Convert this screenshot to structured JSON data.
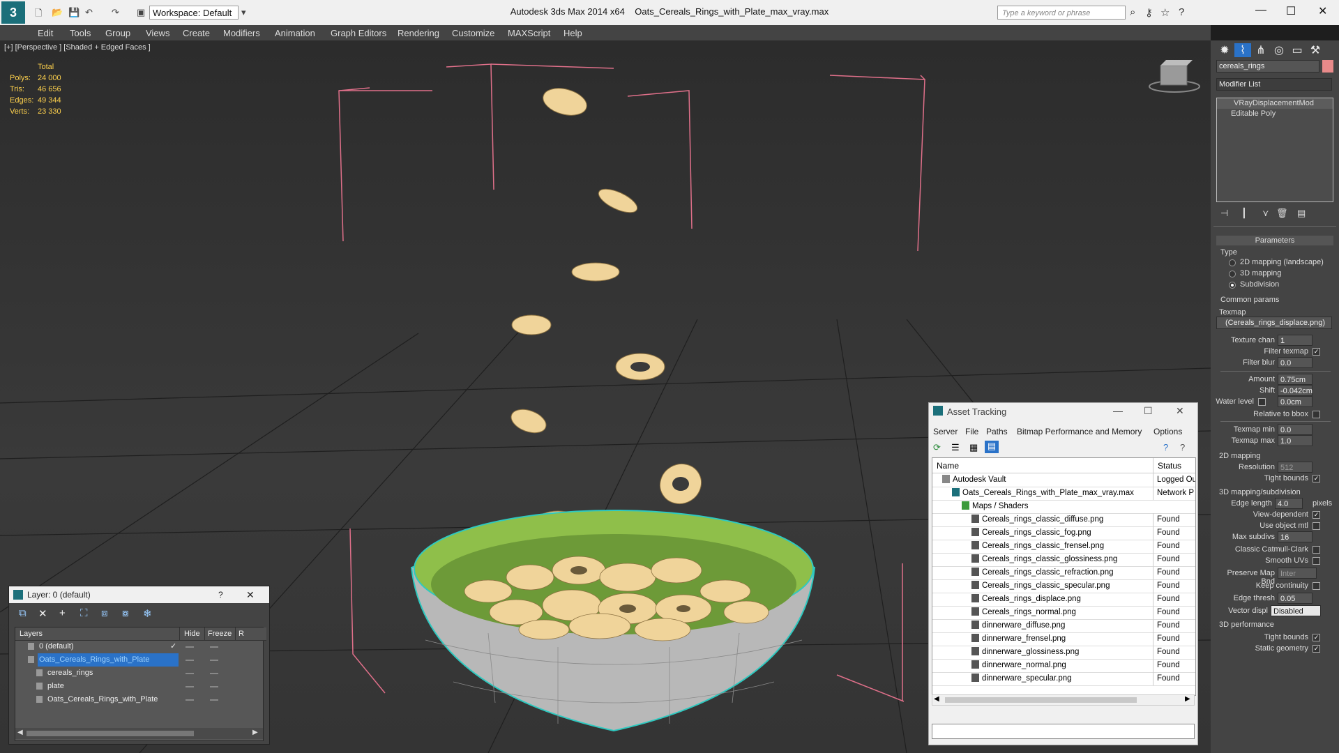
{
  "app": {
    "title": "Autodesk 3ds Max  2014 x64",
    "filename": "Oats_Cereals_Rings_with_Plate_max_vray.max",
    "workspace": "Workspace: Default",
    "search_placeholder": "Type a keyword or phrase"
  },
  "menu": [
    "Edit",
    "Tools",
    "Group",
    "Views",
    "Create",
    "Modifiers",
    "Animation",
    "Graph Editors",
    "Rendering",
    "Customize",
    "MAXScript",
    "Help"
  ],
  "viewport": {
    "label": "[+] [Perspective ] [Shaded + Edged Faces ]",
    "stats": {
      "header": "Total",
      "rows": [
        {
          "label": "Polys:",
          "value": "24 000"
        },
        {
          "label": "Tris:",
          "value": "46 656"
        },
        {
          "label": "Edges:",
          "value": "49 344"
        },
        {
          "label": "Verts:",
          "value": "23 330"
        }
      ]
    }
  },
  "command_panel": {
    "object_name": "cereals_rings",
    "modifier_list": "Modifier List",
    "stack": [
      "VRayDisplacementMod",
      "Editable Poly"
    ],
    "rollout_title": "Parameters",
    "type_label": "Type",
    "type_options": [
      {
        "label": "2D mapping (landscape)",
        "selected": false
      },
      {
        "label": "3D mapping",
        "selected": false
      },
      {
        "label": "Subdivision",
        "selected": true
      }
    ],
    "common_params": "Common params",
    "texmap_label": "Texmap",
    "texmap_value": "(Cereals_rings_displace.png)",
    "texture_chan_label": "Texture chan",
    "texture_chan_value": "1",
    "filter_texmap_label": "Filter texmap",
    "filter_blur_label": "Filter blur",
    "filter_blur_value": "0.0",
    "amount_label": "Amount",
    "amount_value": "0.75cm",
    "shift_label": "Shift",
    "shift_value": "-0.042cm",
    "water_level_label": "Water level",
    "water_level_value": "0.0cm",
    "relative_bbox_label": "Relative to bbox",
    "texmap_min_label": "Texmap min",
    "texmap_min_value": "0.0",
    "texmap_max_label": "Texmap max",
    "texmap_max_value": "1.0",
    "mapping2d_label": "2D mapping",
    "resolution_label": "Resolution",
    "resolution_value": "512",
    "tight_bounds_label": "Tight bounds",
    "mapping3d_label": "3D mapping/subdivision",
    "edge_length_label": "Edge length",
    "edge_length_value": "4.0",
    "edge_length_unit": "pixels",
    "view_dependent_label": "View-dependent",
    "use_object_mtl_label": "Use object mtl",
    "max_subdivs_label": "Max subdivs",
    "max_subdivs_value": "16",
    "classic_catmull_label": "Classic Catmull-Clark",
    "smooth_uvs_label": "Smooth UVs",
    "preserve_map_label": "Preserve Map Bnd",
    "preserve_map_value": "Inter",
    "keep_continuity_label": "Keep continuity",
    "edge_thresh_label": "Edge thresh",
    "edge_thresh_value": "0.05",
    "vector_displ_label": "Vector displ",
    "vector_displ_value": "Disabled",
    "performance_label": "3D performance",
    "tight_bounds2_label": "Tight bounds",
    "static_geometry_label": "Static geometry"
  },
  "asset_tracking": {
    "title": "Asset Tracking",
    "menu": [
      "Server",
      "File",
      "Paths",
      "Bitmap Performance and Memory",
      "Options"
    ],
    "columns": [
      "Name",
      "Status"
    ],
    "rows": [
      {
        "name": "Autodesk Vault",
        "status": "Logged Ou",
        "indent": 0,
        "kind": "vault"
      },
      {
        "name": "Oats_Cereals_Rings_with_Plate_max_vray.max",
        "status": "Network P",
        "indent": 1,
        "kind": "max"
      },
      {
        "name": "Maps / Shaders",
        "status": "",
        "indent": 2,
        "kind": "folder"
      },
      {
        "name": "Cereals_rings_classic_diffuse.png",
        "status": "Found",
        "indent": 3,
        "kind": "file"
      },
      {
        "name": "Cereals_rings_classic_fog.png",
        "status": "Found",
        "indent": 3,
        "kind": "file"
      },
      {
        "name": "Cereals_rings_classic_frensel.png",
        "status": "Found",
        "indent": 3,
        "kind": "file"
      },
      {
        "name": "Cereals_rings_classic_glossiness.png",
        "status": "Found",
        "indent": 3,
        "kind": "file"
      },
      {
        "name": "Cereals_rings_classic_refraction.png",
        "status": "Found",
        "indent": 3,
        "kind": "file"
      },
      {
        "name": "Cereals_rings_classic_specular.png",
        "status": "Found",
        "indent": 3,
        "kind": "file"
      },
      {
        "name": "Cereals_rings_displace.png",
        "status": "Found",
        "indent": 3,
        "kind": "file"
      },
      {
        "name": "Cereals_rings_normal.png",
        "status": "Found",
        "indent": 3,
        "kind": "file"
      },
      {
        "name": "dinnerware_diffuse.png",
        "status": "Found",
        "indent": 3,
        "kind": "file"
      },
      {
        "name": "dinnerware_frensel.png",
        "status": "Found",
        "indent": 3,
        "kind": "file"
      },
      {
        "name": "dinnerware_glossiness.png",
        "status": "Found",
        "indent": 3,
        "kind": "file"
      },
      {
        "name": "dinnerware_normal.png",
        "status": "Found",
        "indent": 3,
        "kind": "file"
      },
      {
        "name": "dinnerware_specular.png",
        "status": "Found",
        "indent": 3,
        "kind": "file"
      }
    ]
  },
  "layers": {
    "title": "Layer: 0 (default)",
    "columns": [
      "Layers",
      "Hide",
      "Freeze",
      "R"
    ],
    "rows": [
      {
        "name": "0 (default)",
        "indent": 1,
        "selected": false
      },
      {
        "name": "Oats_Cereals_Rings_with_Plate",
        "indent": 1,
        "selected": true
      },
      {
        "name": "cereals_rings",
        "indent": 2,
        "selected": false
      },
      {
        "name": "plate",
        "indent": 2,
        "selected": false
      },
      {
        "name": "Oats_Cereals_Rings_with_Plate",
        "indent": 2,
        "selected": false
      }
    ]
  },
  "colors": {
    "accent": "#1b6f7a",
    "selection": "#2a72c8",
    "stats": "#ffd24d",
    "bbox": "#e0708a",
    "cereal": "#f0d49a",
    "bowl_inner": "#8fbf4a"
  }
}
